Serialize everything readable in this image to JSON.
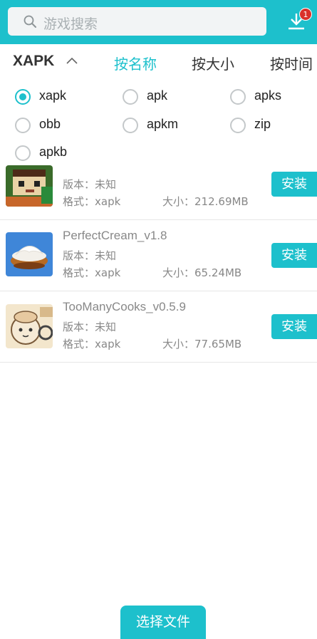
{
  "search": {
    "placeholder": "游戏搜索"
  },
  "download": {
    "badge": "1"
  },
  "filter": {
    "type_label": "XAPK",
    "sorts": [
      "按名称",
      "按大小",
      "按时间"
    ],
    "active_sort": "按名称"
  },
  "formats": [
    {
      "label": "xapk",
      "checked": true
    },
    {
      "label": "apk",
      "checked": false
    },
    {
      "label": "apks",
      "checked": false
    },
    {
      "label": "obb",
      "checked": false
    },
    {
      "label": "apkm",
      "checked": false
    },
    {
      "label": "zip",
      "checked": false
    },
    {
      "label": "apkb",
      "checked": false
    }
  ],
  "items": [
    {
      "name": "",
      "version": "版本：未知",
      "format": "格式：xapk",
      "size": "大小：212.69MB",
      "install": "安装"
    },
    {
      "name": "PerfectCream_v1.8",
      "version": "版本：未知",
      "format": "格式：xapk",
      "size": "大小：65.24MB",
      "install": "安装"
    },
    {
      "name": "TooManyCooks_v0.5.9",
      "version": "版本：未知",
      "format": "格式：xapk",
      "size": "大小：77.65MB",
      "install": "安装"
    }
  ],
  "bottom": {
    "select_file": "选择文件"
  },
  "colors": {
    "accent": "#1dc0cc",
    "badge": "#d9312b"
  }
}
